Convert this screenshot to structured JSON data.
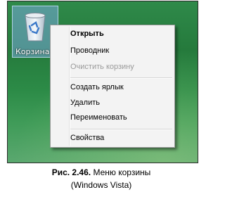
{
  "desktop": {
    "icon_name": "bin-icon",
    "icon_label": "Корзина"
  },
  "menu": {
    "items": [
      {
        "label": "Открыть",
        "bold": true,
        "enabled": true
      },
      {
        "label": "Проводник",
        "enabled": true
      },
      {
        "label": "Очистить корзину",
        "enabled": false
      },
      {
        "label": "Создать ярлык",
        "enabled": true
      },
      {
        "label": "Удалить",
        "enabled": true
      },
      {
        "label": "Переименовать",
        "enabled": true
      },
      {
        "label": "Свойства",
        "enabled": true
      }
    ]
  },
  "caption": {
    "figure": "Рис. 2.46.",
    "text": "Меню корзины",
    "line2": "(Windows Vista)"
  }
}
